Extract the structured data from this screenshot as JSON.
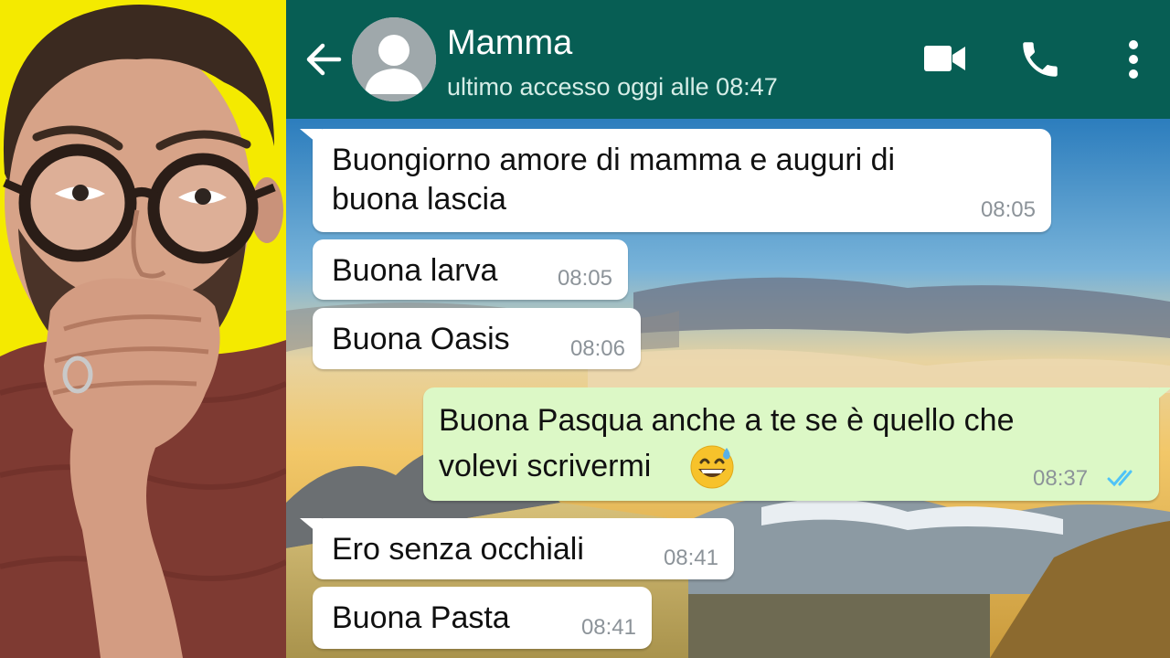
{
  "chat": {
    "header": {
      "contact_name": "Mamma",
      "status": "ultimo accesso oggi alle 08:47",
      "icons": [
        "back-arrow-icon",
        "default-avatar-icon",
        "video-call-icon",
        "phone-icon",
        "more-vert-icon"
      ]
    },
    "messages": [
      {
        "direction": "incoming",
        "line1": "Buongiorno amore di mamma e auguri di",
        "line2": "buona lascia",
        "time": "08:05"
      },
      {
        "direction": "incoming",
        "text": "Buona larva",
        "time": "08:05"
      },
      {
        "direction": "incoming",
        "text": "Buona Oasis",
        "time": "08:06"
      },
      {
        "direction": "outgoing",
        "line1": "Buona Pasqua anche a te se è quello che",
        "line2": "volevi scrivermi",
        "emoji": "grinning-face-with-sweat-emoji",
        "time": "08:37",
        "read": true
      },
      {
        "direction": "incoming",
        "text": "Ero senza occhiali",
        "time": "08:41"
      },
      {
        "direction": "incoming",
        "text": "Buona Pasta",
        "time": "08:41"
      }
    ]
  },
  "colors": {
    "header": "#075e54",
    "incoming_bubble": "#ffffff",
    "outgoing_bubble": "#dcf8c6",
    "read_ticks": "#4fc3f7",
    "left_background": "#f4ea00"
  }
}
